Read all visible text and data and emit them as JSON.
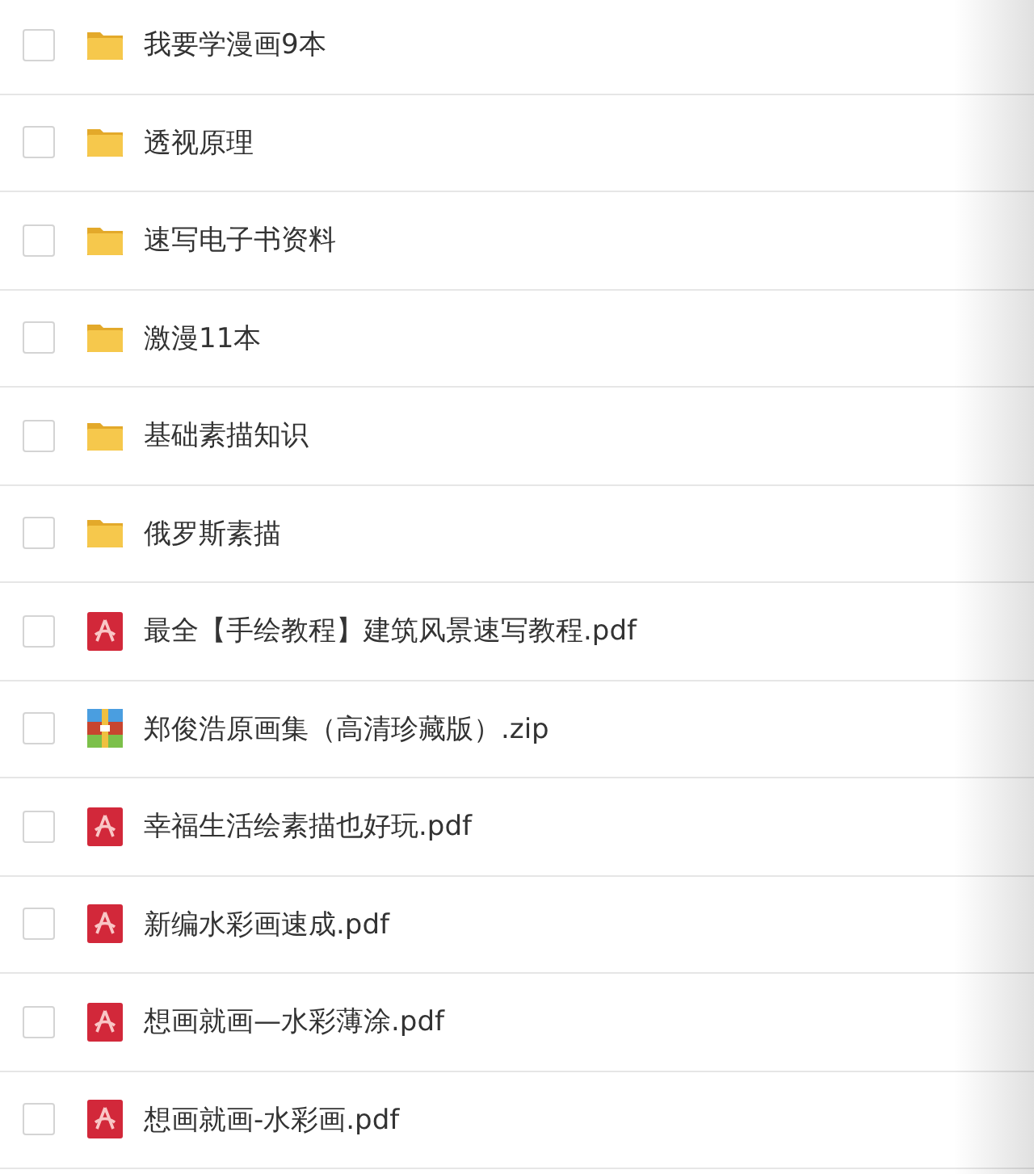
{
  "files": [
    {
      "name": "我要学漫画9本",
      "kind": "folder",
      "checked": false
    },
    {
      "name": "透视原理",
      "kind": "folder",
      "checked": false
    },
    {
      "name": "速写电子书资料",
      "kind": "folder",
      "checked": false
    },
    {
      "name": "激漫11本",
      "kind": "folder",
      "checked": false
    },
    {
      "name": "基础素描知识",
      "kind": "folder",
      "checked": false
    },
    {
      "name": "俄罗斯素描",
      "kind": "folder",
      "checked": false
    },
    {
      "name": "最全【手绘教程】建筑风景速写教程.pdf",
      "kind": "pdf",
      "checked": false
    },
    {
      "name": "郑俊浩原画集（高清珍藏版）.zip",
      "kind": "zip",
      "checked": false
    },
    {
      "name": "幸福生活绘素描也好玩.pdf",
      "kind": "pdf",
      "checked": false
    },
    {
      "name": "新编水彩画速成.pdf",
      "kind": "pdf",
      "checked": false
    },
    {
      "name": "想画就画—水彩薄涂.pdf",
      "kind": "pdf",
      "checked": false
    },
    {
      "name": "想画就画-水彩画.pdf",
      "kind": "pdf",
      "checked": false
    }
  ]
}
